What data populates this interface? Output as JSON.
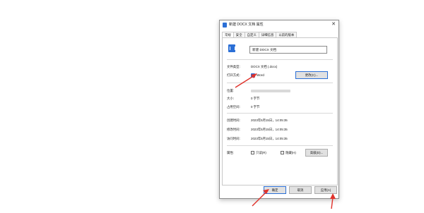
{
  "dialog": {
    "title": "新建 DOCX 文档 属性",
    "close_symbol": "✕"
  },
  "tabs": [
    "常规",
    "安全",
    "自定义",
    "详细信息",
    "以前的版本"
  ],
  "general": {
    "file_name": "新建 DOCX 文档",
    "file_type_label": "文件类型:",
    "file_type_value": "DOCX 文档 (.docx)",
    "open_with_label": "打开方式:",
    "open_with_value": "Word",
    "change_button": "更改(C)...",
    "location_label": "位置:",
    "size_label": "大小:",
    "size_value": "0 字节",
    "size_on_disk_label": "占用空间:",
    "size_on_disk_value": "0 字节",
    "created_label": "创建时间:",
    "created_value": "2023年5月15日，14:05:35",
    "modified_label": "修改时间:",
    "modified_value": "2023年5月15日，14:05:35",
    "accessed_label": "访问时间:",
    "accessed_value": "2023年5月15日，14:05:35",
    "attributes_label": "属性:",
    "readonly_label": "只读(R)",
    "hidden_label": "隐藏(H)",
    "advanced_button": "高级(D)..."
  },
  "footer": {
    "ok_button": "确定",
    "cancel_button": "取消",
    "apply_button": "应用(A)"
  },
  "colors": {
    "annotation_arrow": "#e0322b",
    "accent": "#2b6fd6"
  }
}
